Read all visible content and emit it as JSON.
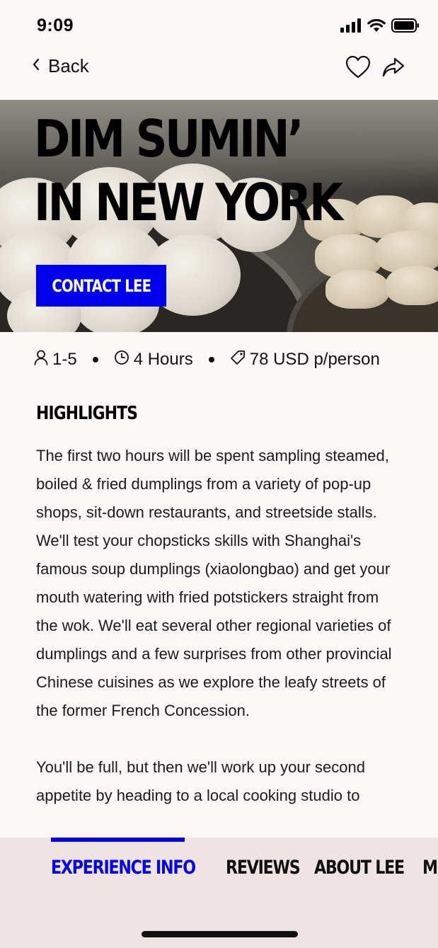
{
  "status_bar": {
    "time": "9:09",
    "icons": [
      "signal-icon",
      "wifi-icon",
      "battery-icon"
    ]
  },
  "nav": {
    "back_label": "Back",
    "icons": [
      "chevron-left-icon",
      "heart-icon",
      "share-icon"
    ]
  },
  "hero": {
    "title_line1": "DIM SUMIN’",
    "title_line2": "IN NEW YORK",
    "contact_label": "CONTACT LEE"
  },
  "meta": {
    "guests": "1-5",
    "duration": "4 Hours",
    "price": "78 USD p/person",
    "icons": [
      "person-icon",
      "clock-icon",
      "tag-icon"
    ]
  },
  "highlights": {
    "heading": "HIGHLIGHTS",
    "paragraph1": "The first two hours will be spent sampling steamed, boiled & fried dumplings from a variety of pop-up shops, sit-down restaurants, and streetside stalls. We'll test your chopsticks skills with Shanghai's famous soup dumplings (xiaolongbao) and get your mouth watering with fried potstickers straight from the wok. We'll eat several other regional varieties of dumplings and a few surprises from other provincial Chinese cuisines as we explore the leafy streets of the former French Concession.",
    "paragraph2": "You'll be full, but then we'll work up your second appetite by heading to a local cooking studio to"
  },
  "tabs": [
    {
      "label": "EXPERIENCE INFO",
      "active": true
    },
    {
      "label": "REVIEWS",
      "active": false
    },
    {
      "label": "ABOUT LEE",
      "active": false
    },
    {
      "label": "MORE",
      "active": false
    }
  ],
  "colors": {
    "accent": "#0000ee",
    "background": "#fdf8f8",
    "tab_bar_background": "#f0e3e3"
  }
}
